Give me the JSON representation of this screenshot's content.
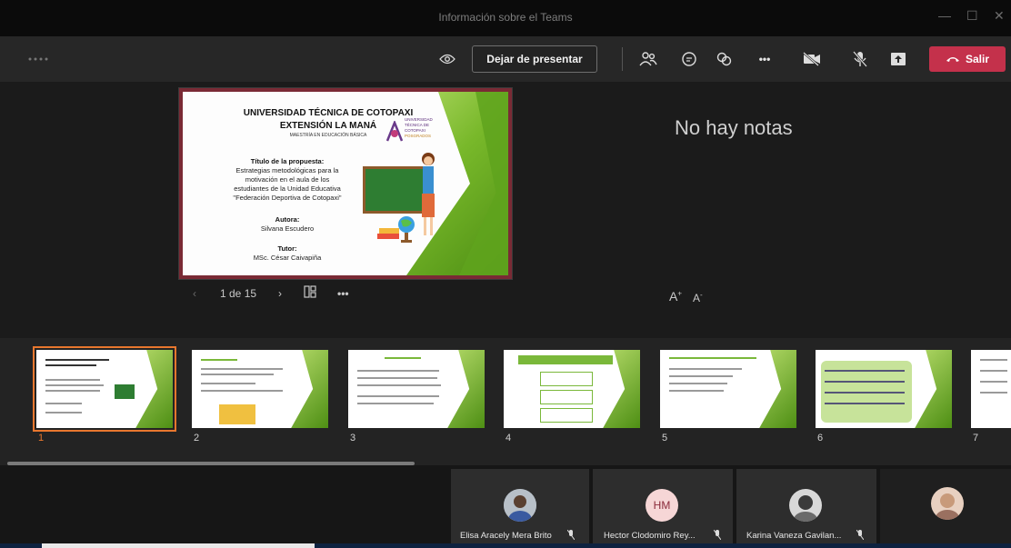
{
  "window": {
    "title": "Información sobre el Teams",
    "controls": [
      "—",
      "☐",
      "✕"
    ]
  },
  "toolbar": {
    "menu_icon": "dots-loading-icon",
    "stop_presenting": "Dejar de presentar",
    "leave": "Salir",
    "more": "•••"
  },
  "slide": {
    "title1": "UNIVERSIDAD TÉCNICA DE COTOPAXI",
    "title2": "EXTENSIÓN LA MANÁ",
    "subtitle": "MAESTRÍA EN EDUCACIÓN BÁSICA",
    "logo_text": [
      "UNIVERSIDAD",
      "TÉCNICA DE",
      "COTOPAXI",
      "POSGRADOS"
    ],
    "proposal_heading": "Título de la propuesta:",
    "proposal_lines": [
      "Estrategias metodológicas para la",
      "motivación en el aula de los",
      "estudiantes de la Unidad Educativa",
      "\"Federación Deportiva de Cotopaxi\""
    ],
    "author_heading": "Autora:",
    "author": "Silvana Escudero",
    "tutor_heading": "Tutor:",
    "tutor": "MSc. César Caivapiña"
  },
  "notes": {
    "empty_text": "No hay notas"
  },
  "navigation": {
    "page_indicator": "1 de 15",
    "prev": "‹",
    "next": "›",
    "more": "•••"
  },
  "font_controls": {
    "increase": "A",
    "decrease": "A"
  },
  "thumbnails": [
    "1",
    "2",
    "3",
    "4",
    "5",
    "6",
    "7"
  ],
  "participants": [
    {
      "name": "Elisa Aracely Mera Brito",
      "initials": ""
    },
    {
      "name": "Hector Clodomiro Rey...",
      "initials": "HM"
    },
    {
      "name": "Karina Vaneza Gavilan...",
      "initials": ""
    },
    {
      "name": "",
      "initials": ""
    }
  ],
  "colors": {
    "leave": "#c4314b",
    "selected_thumb": "#e8772e",
    "slide_green": "#78b82a",
    "avatar_hm": "#f6d6d6"
  }
}
